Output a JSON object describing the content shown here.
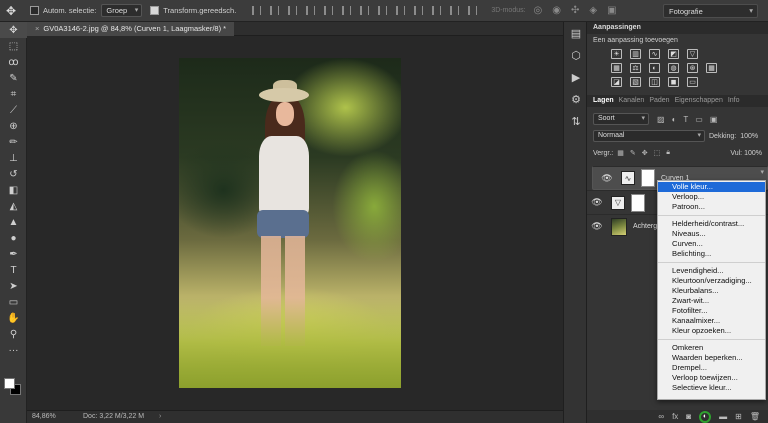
{
  "options_bar": {
    "tool_icon": "move-icon",
    "auto_select_label": "Autom. selectie:",
    "auto_select_value": "Groep",
    "transform_label": "Transform.gereedsch.",
    "mode_3d_label": "3D-modus:",
    "workspace": "Fotografie"
  },
  "document": {
    "tab_close": "×",
    "tab_title": "GV0A3146-2.jpg @ 84,8% (Curven 1, Laagmasker/8) *",
    "status_zoom": "84,86%",
    "status_doc": "Doc: 3,22 M/3,22 M",
    "status_arrow": "›"
  },
  "panels": {
    "adjustments_tab": "Aanpassingen",
    "adjustments_sub": "Een aanpassing toevoegen",
    "layers_tabs": [
      "Lagen",
      "Kanalen",
      "Paden",
      "Eigenschappen",
      "Info"
    ],
    "filter_kind": "Soort",
    "blend_mode": "Normaal",
    "opacity_label": "Dekking:",
    "opacity_value": "100%",
    "lock_label": "Vergr.:",
    "fill_label": "Vul:",
    "fill_value": "100%",
    "layers": [
      {
        "name": "Curven 1",
        "selected": true
      },
      {
        "name": "",
        "selected": false
      },
      {
        "name": "Achtergrond",
        "selected": false
      }
    ]
  },
  "adjustment_menu": {
    "group1": [
      "Volle kleur...",
      "Verloop...",
      "Patroon..."
    ],
    "group2": [
      "Helderheid/contrast...",
      "Niveaus...",
      "Curven...",
      "Belichting..."
    ],
    "group3": [
      "Levendigheid...",
      "Kleurtoon/verzadiging...",
      "Kleurbalans...",
      "Zwart-wit...",
      "Fotofilter...",
      "Kanaalmixer...",
      "Kleur opzoeken..."
    ],
    "group4": [
      "Omkeren",
      "Waarden beperken...",
      "Drempel...",
      "Verloop toewijzen...",
      "Selectieve kleur..."
    ],
    "highlighted": "Volle kleur..."
  },
  "colors": {
    "menu_highlight": "#1e6ad8",
    "adjustment_button_ring": "#2fa12f"
  }
}
